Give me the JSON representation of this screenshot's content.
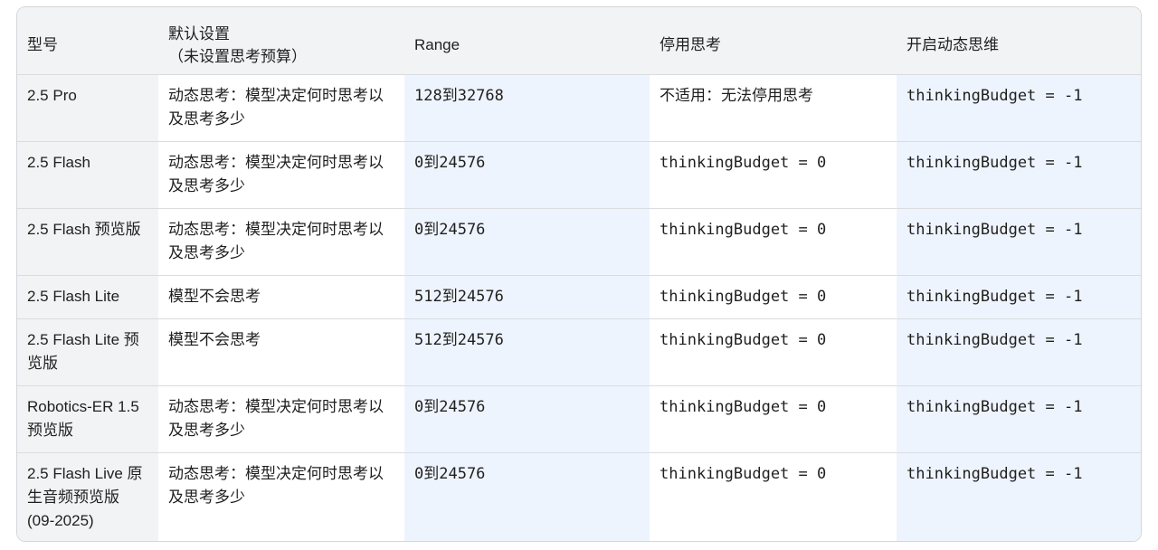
{
  "table": {
    "headers": {
      "model": "型号",
      "default_line1": "默认设置",
      "default_line2": "（未设置思考预算）",
      "range": "Range",
      "disable": "停用思考",
      "dynamic": "开启动态思维"
    },
    "rows": [
      {
        "model": "2.5 Pro",
        "default": "动态思考：模型决定何时思考以及思考多少",
        "range": "128到32768",
        "disable": "不适用：无法停用思考",
        "dynamic": "thinkingBudget = -1"
      },
      {
        "model": "2.5 Flash",
        "default": "动态思考：模型决定何时思考以及思考多少",
        "range": "0到24576",
        "disable": "thinkingBudget = 0",
        "dynamic": "thinkingBudget = -1"
      },
      {
        "model": "2.5 Flash 预览版",
        "default": "动态思考：模型决定何时思考以及思考多少",
        "range": "0到24576",
        "disable": "thinkingBudget = 0",
        "dynamic": "thinkingBudget = -1"
      },
      {
        "model": "2.5 Flash Lite",
        "default": "模型不会思考",
        "range": "512到24576",
        "disable": "thinkingBudget = 0",
        "dynamic": "thinkingBudget = -1"
      },
      {
        "model": "2.5 Flash Lite 预览版",
        "default": "模型不会思考",
        "range": "512到24576",
        "disable": "thinkingBudget = 0",
        "dynamic": "thinkingBudget = -1"
      },
      {
        "model": "Robotics-ER 1.5 预览版",
        "default": "动态思考：模型决定何时思考以及思考多少",
        "range": "0到24576",
        "disable": "thinkingBudget = 0",
        "dynamic": "thinkingBudget = -1"
      },
      {
        "model": "2.5 Flash Live 原生音频预览版 (09-2025)",
        "default": "动态思考：模型决定何时思考以及思考多少",
        "range": "0到24576",
        "disable": "thinkingBudget = 0",
        "dynamic": "thinkingBudget = -1"
      }
    ]
  }
}
